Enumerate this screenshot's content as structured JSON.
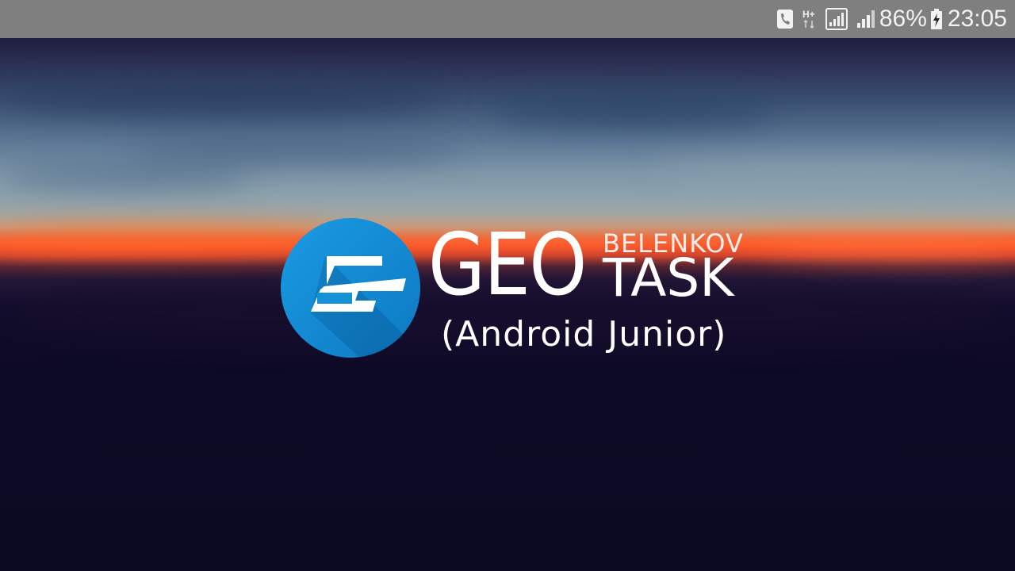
{
  "status_bar": {
    "icons": [
      "phone-call-icon",
      "network-h-plus-icon",
      "signal-sim1-icon",
      "signal-sim2-icon",
      "battery-charging-icon"
    ],
    "network_type": "H+",
    "battery_percent": "86%",
    "time": "23:05",
    "battery_level": 0.86
  },
  "splash": {
    "logo_icon": "geotask-g-icon",
    "logo_color": "#1591d8",
    "brand_word": "GEO",
    "brand_author": "BELENKOV",
    "brand_product": "TASK",
    "subtitle": "(Android Junior)"
  }
}
